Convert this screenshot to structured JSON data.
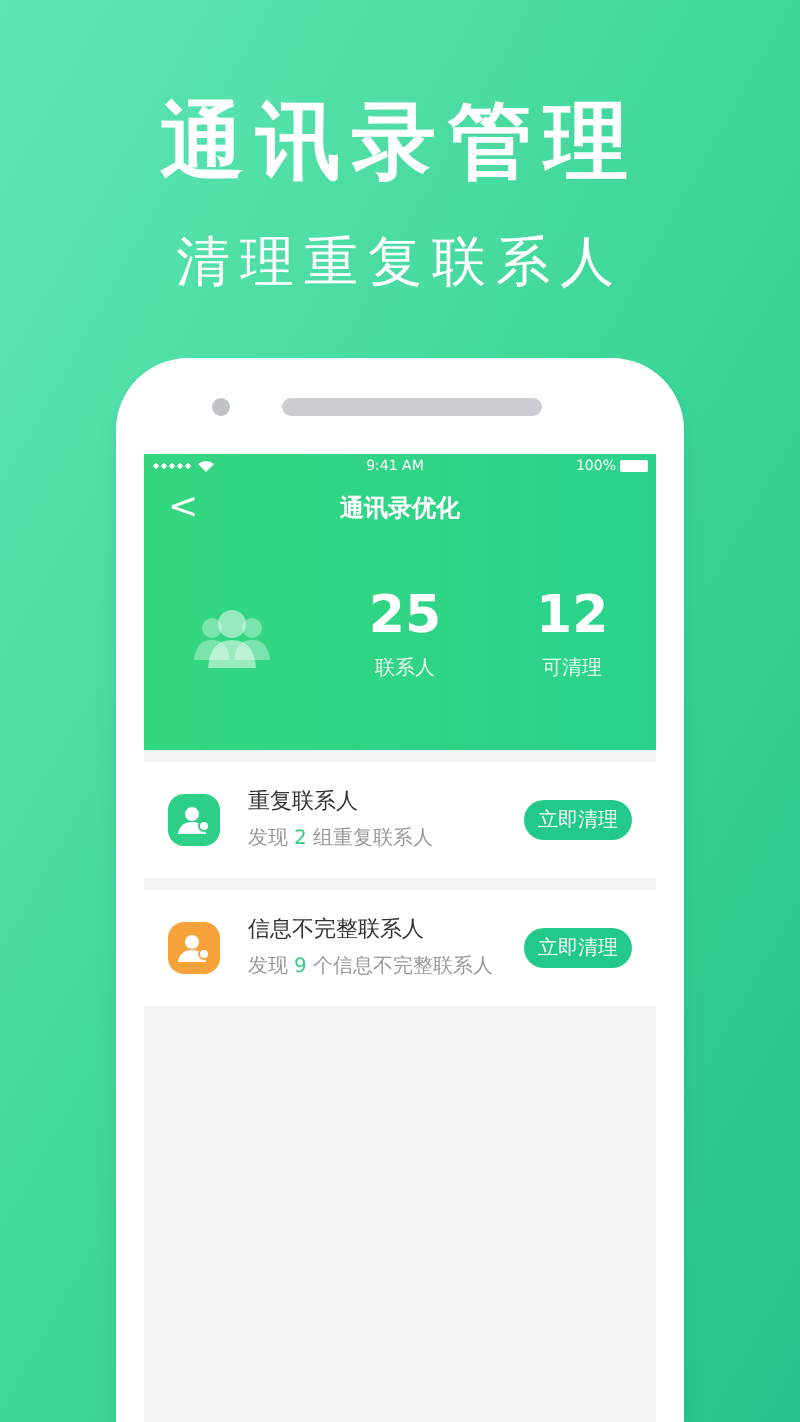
{
  "headline": "通讯录管理",
  "subheadline": "清理重复联系人",
  "status_bar": {
    "time": "9:41 AM",
    "battery": "100%"
  },
  "nav": {
    "back": "<",
    "title": "通讯录优化"
  },
  "stats": [
    {
      "value": "25",
      "label": "联系人"
    },
    {
      "value": "12",
      "label": "可清理"
    }
  ],
  "items": [
    {
      "title": "重复联系人",
      "desc_prefix": "发现",
      "count": "2",
      "desc_suffix": "组重复联系人",
      "button": "立即清理",
      "color": "#2ecf87"
    },
    {
      "title": "信息不完整联系人",
      "desc_prefix": "发现",
      "count": "9",
      "desc_suffix": "个信息不完整联系人",
      "button": "立即清理",
      "color": "#f7a23b"
    }
  ]
}
